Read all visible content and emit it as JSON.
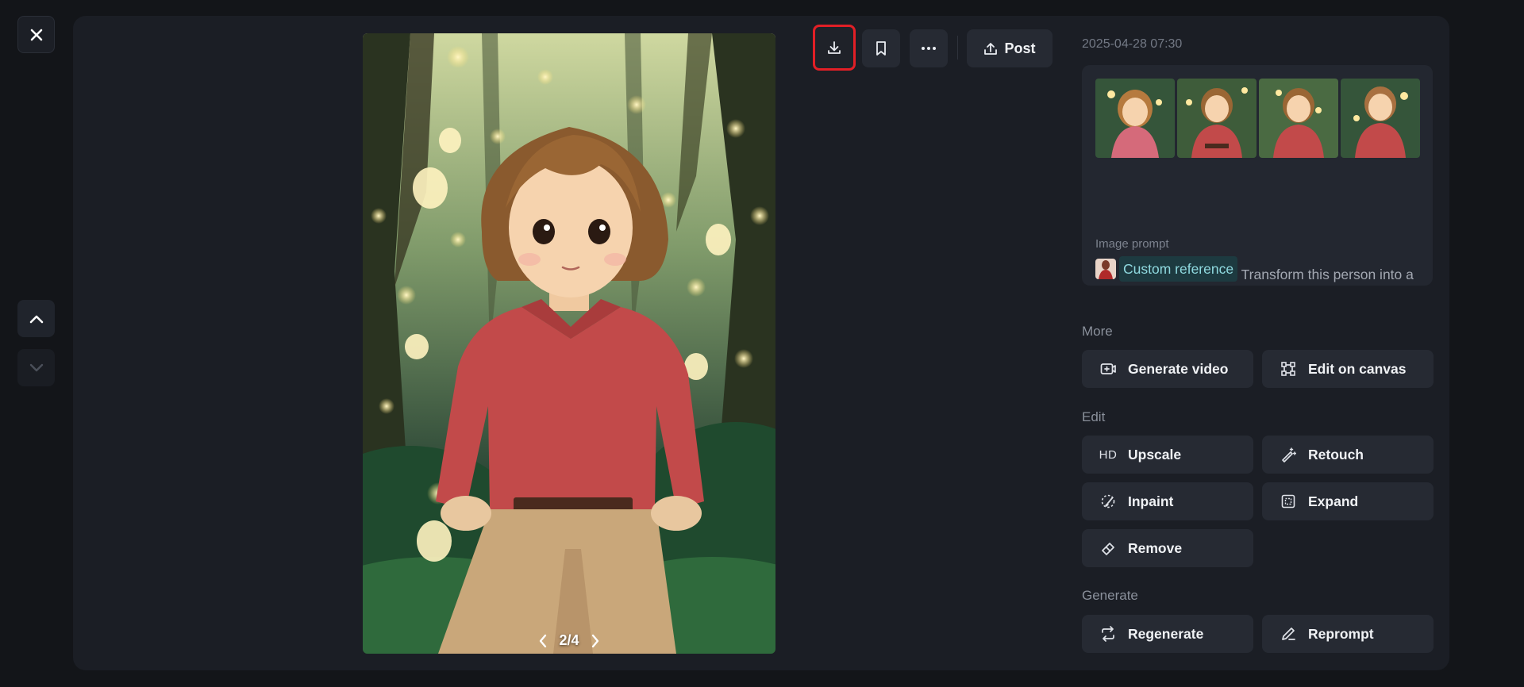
{
  "window": {
    "close_icon": "close-icon",
    "nav_up_icon": "chevron-up-icon",
    "nav_down_icon": "chevron-down-icon"
  },
  "image": {
    "pager": "2/4",
    "prev_icon": "chevron-left-icon",
    "next_icon": "chevron-right-icon"
  },
  "toolbar": {
    "download_icon": "download-icon",
    "bookmark_icon": "bookmark-icon",
    "more_icon": "more-icon",
    "post_label": "Post",
    "highlight_color": "#e21f26"
  },
  "details": {
    "timestamp": "2025-04-28 07:30",
    "prompt_label": "Image prompt",
    "reference_tag": "Custom reference",
    "prompt_text": " Transform this person into a Studio Ghibli anime character with the classic Miyazaki style. Give them Ghibli-style features with large expressive eyes, simplified facial details, and sof"
  },
  "sections": {
    "more": "More",
    "edit": "Edit",
    "generate": "Generate"
  },
  "actions": {
    "generate_video": "Generate video",
    "edit_on_canvas": "Edit on canvas",
    "upscale_badge": "HD",
    "upscale": "Upscale",
    "retouch": "Retouch",
    "inpaint": "Inpaint",
    "expand": "Expand",
    "remove": "Remove",
    "regenerate": "Regenerate",
    "reprompt": "Reprompt"
  },
  "colors": {
    "background": "#131519",
    "panel": "#1b1e25",
    "button": "#262a33",
    "reference_tag_bg": "#1d3a40",
    "reference_tag_text": "#8fd9df"
  }
}
